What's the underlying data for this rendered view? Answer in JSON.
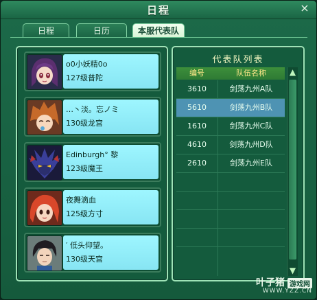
{
  "window": {
    "title": "日程",
    "close_glyph": "×"
  },
  "tabs": [
    {
      "label": "日程"
    },
    {
      "label": "日历"
    },
    {
      "label": "本服代表队"
    }
  ],
  "members": [
    {
      "name": "o0小妖精0o",
      "level": "127级普陀",
      "avatar": "purple-haired-girl-avatar"
    },
    {
      "name": "…丶淡。忘ノミ",
      "level": "130级龙宫",
      "avatar": "orange-haired-boy-avatar"
    },
    {
      "name": "Edinburgh° 黎",
      "level": "123级魔王",
      "avatar": "demon-king-avatar"
    },
    {
      "name": "夜舞滴血",
      "level": "125级方寸",
      "avatar": "red-haired-girl-avatar"
    },
    {
      "name": "′ 低头仰望。",
      "level": "130级天宫",
      "avatar": "dark-haired-youth-avatar"
    }
  ],
  "team_list": {
    "title": "代表队列表",
    "headers": {
      "id": "编号",
      "name": "队伍名称"
    },
    "rows": [
      {
        "id": "3610",
        "name": "剑荡九州A队"
      },
      {
        "id": "5610",
        "name": "剑荡九州B队"
      },
      {
        "id": "1610",
        "name": "剑荡九州C队"
      },
      {
        "id": "4610",
        "name": "剑荡九州D队"
      },
      {
        "id": "2610",
        "name": "剑荡九州E队"
      }
    ],
    "selected_index": 1
  },
  "watermark": {
    "main": "叶子猪",
    "tag": "游戏网",
    "url": "WWW.YZZ.CN"
  },
  "colors": {
    "accent_green": "#1a6544",
    "info_cyan": "#9ef6ff",
    "selected_row": "#4e93b3",
    "header_gold": "#ffe889"
  }
}
